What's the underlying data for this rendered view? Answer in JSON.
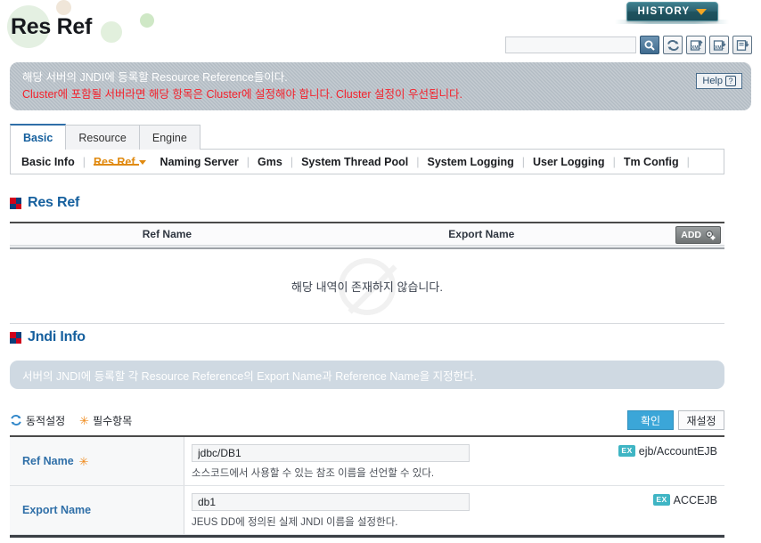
{
  "header": {
    "title": "Res Ref",
    "history_label": "HISTORY",
    "history_caret_icon": "chevron-down-icon"
  },
  "toolbar": {
    "search_value": "",
    "search_placeholder": "",
    "buttons": [
      {
        "icon": "search-icon",
        "name": "search-button"
      },
      {
        "icon": "refresh-icon",
        "name": "refresh-button"
      },
      {
        "icon": "xml-upload-icon",
        "name": "xml-upload-button"
      },
      {
        "icon": "xml-download-icon",
        "name": "xml-download-button"
      },
      {
        "icon": "export-report-icon",
        "name": "export-report-button"
      }
    ]
  },
  "description": {
    "line1": "해당 서버의 JNDI에 등록할 Resource Reference들이다.",
    "line2": "Cluster에 포함될 서버라면 해당 항목은 Cluster에 설정해야 합니다. Cluster 설정이 우선됩니다.",
    "help_label": "Help",
    "help_mark": "?"
  },
  "tabs": [
    {
      "label": "Basic",
      "active": true
    },
    {
      "label": "Resource",
      "active": false
    },
    {
      "label": "Engine",
      "active": false
    }
  ],
  "subtabs": [
    {
      "label": "Basic Info",
      "active": false,
      "dropdown": false
    },
    {
      "label": "Res Ref",
      "active": true,
      "dropdown": true
    },
    {
      "label": "Naming Server",
      "active": false,
      "dropdown": false
    },
    {
      "label": "Gms",
      "active": false,
      "dropdown": false
    },
    {
      "label": "System Thread Pool",
      "active": false,
      "dropdown": false
    },
    {
      "label": "System Logging",
      "active": false,
      "dropdown": false
    },
    {
      "label": "User Logging",
      "active": false,
      "dropdown": false
    },
    {
      "label": "Tm Config",
      "active": false,
      "dropdown": false
    }
  ],
  "res_ref_section": {
    "title": "Res Ref",
    "columns": [
      "Ref Name",
      "Export Name"
    ],
    "add_label": "ADD",
    "add_icon": "add-gear-icon",
    "empty_message": "해당 내역이 존재하지 않습니다.",
    "rows": []
  },
  "jndi_section": {
    "title": "Jndi Info",
    "banner": "서버의 JNDI에 등록할 각 Resource Reference의 Export Name과 Reference Name을 지정한다.",
    "legend": [
      {
        "icon": "dynamic-config-icon",
        "label": "동적설정"
      },
      {
        "icon": "required-asterisk-icon",
        "label": "필수항목"
      }
    ],
    "confirm_label": "확인",
    "reset_label": "재설정",
    "fields": [
      {
        "label": "Ref Name",
        "required": true,
        "value": "jdbc/DB1",
        "placeholder": "",
        "help": "소스코드에서 사용할 수 있는 참조 이름을 선언할 수 있다.",
        "example_badge": "EX",
        "example_text": "ejb/AccountEJB"
      },
      {
        "label": "Export Name",
        "required": false,
        "value": "db1",
        "placeholder": "",
        "help": "JEUS DD에 정의된 실제 JNDI 이름을 설정한다.",
        "example_badge": "EX",
        "example_text": "ACCEJB"
      }
    ]
  },
  "colors": {
    "accent_blue": "#16609e",
    "accent_orange": "#e08a10",
    "error_red": "#f3222c",
    "badge_teal": "#3fb5c4",
    "confirm_blue": "#3ba6d8"
  }
}
